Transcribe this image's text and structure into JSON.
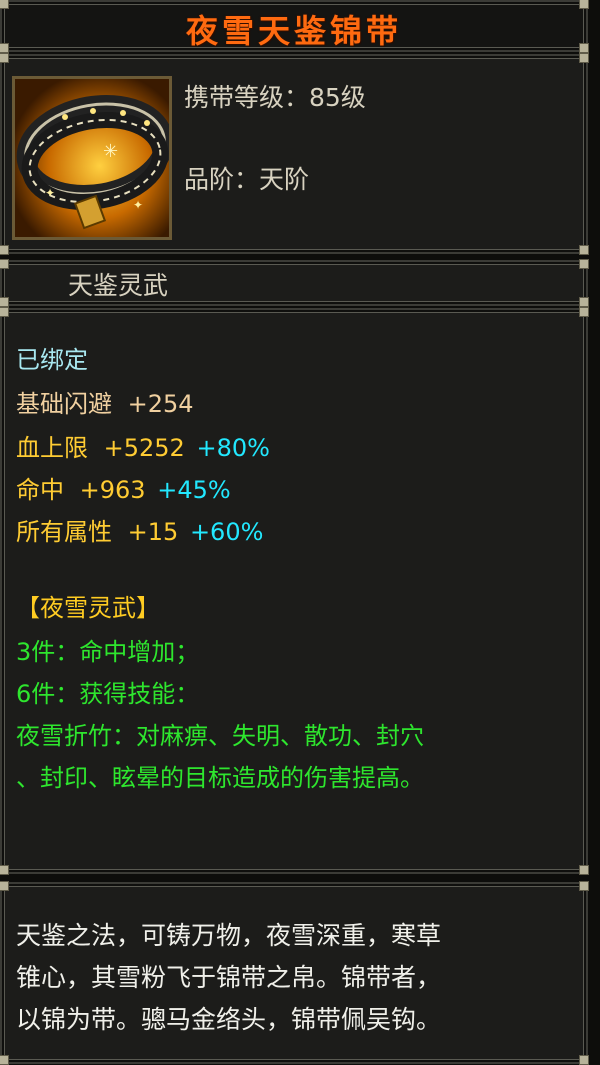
{
  "item": {
    "name": "夜雪天鉴锦带",
    "level_line": "携带等级：85级",
    "grade_line": "品阶：天阶",
    "icon": "belt-icon",
    "set_label": "天鉴灵武"
  },
  "stats": {
    "bound": "已绑定",
    "base_label": "基础闪避",
    "base_value": "+254",
    "lines": [
      {
        "label": "血上限",
        "value": "+5252",
        "bonus": "+80%"
      },
      {
        "label": "命中",
        "value": "+963",
        "bonus": "+45%"
      },
      {
        "label": "所有属性",
        "value": "+15",
        "bonus": "+60%"
      }
    ]
  },
  "set_bonus": {
    "title": "【夜雪灵武】",
    "piece3": "3件：命中增加；",
    "piece6": "6件：获得技能：",
    "skill_line1": "夜雪折竹：对麻痹、失明、散功、封穴",
    "skill_line2": "、封印、眩晕的目标造成的伤害提高。"
  },
  "description": [
    "天鉴之法，可铸万物，夜雪深重，寒草",
    "锥心，其雪粉飞于锦带之帛。锦带者，",
    "以锦为带。骢马金络头，锦带佩吴钩。"
  ],
  "colors": {
    "title": "#ff6a10",
    "bound": "#a8e8f0",
    "base": "#f0d0a0",
    "value": "#ffcc33",
    "bonus": "#22e8ff",
    "skill": "#2ee62e"
  }
}
